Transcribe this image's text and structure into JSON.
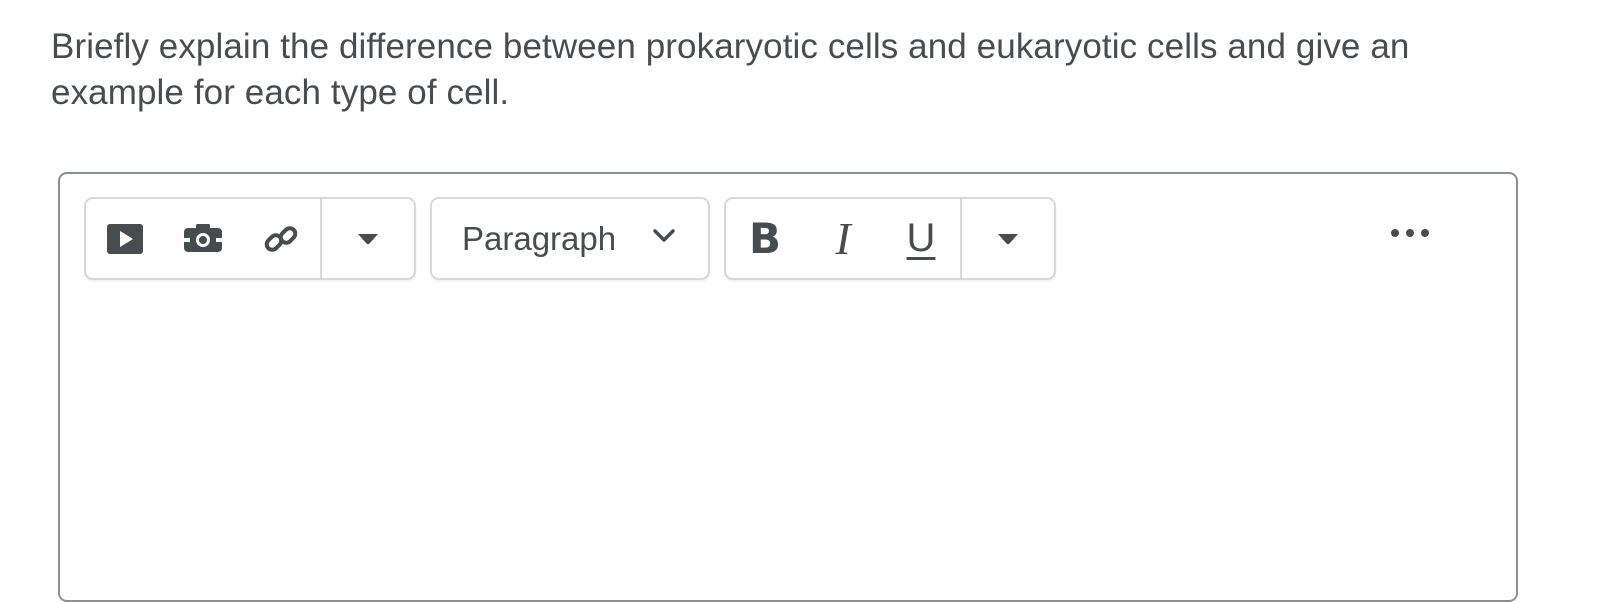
{
  "question": {
    "text": "Briefly explain the difference between prokaryotic cells and eukaryotic cells and give an example for each type of cell."
  },
  "editor": {
    "toolbar": {
      "insert_group": {
        "icons": [
          "insert-video-icon",
          "insert-image-icon",
          "insert-link-icon",
          "caret-down-icon"
        ]
      },
      "format_select": {
        "value": "Paragraph",
        "icon": "chevron-down-icon"
      },
      "style_group": {
        "bold_label": "B",
        "italic_label": "I",
        "underline_label": "U",
        "more_icon": "caret-down-icon"
      },
      "overflow_icon": "more-horizontal-icon"
    },
    "body_text": ""
  },
  "colors": {
    "text": "#494c4e",
    "border": "#8c8f91",
    "group_border": "#d6d8da"
  }
}
